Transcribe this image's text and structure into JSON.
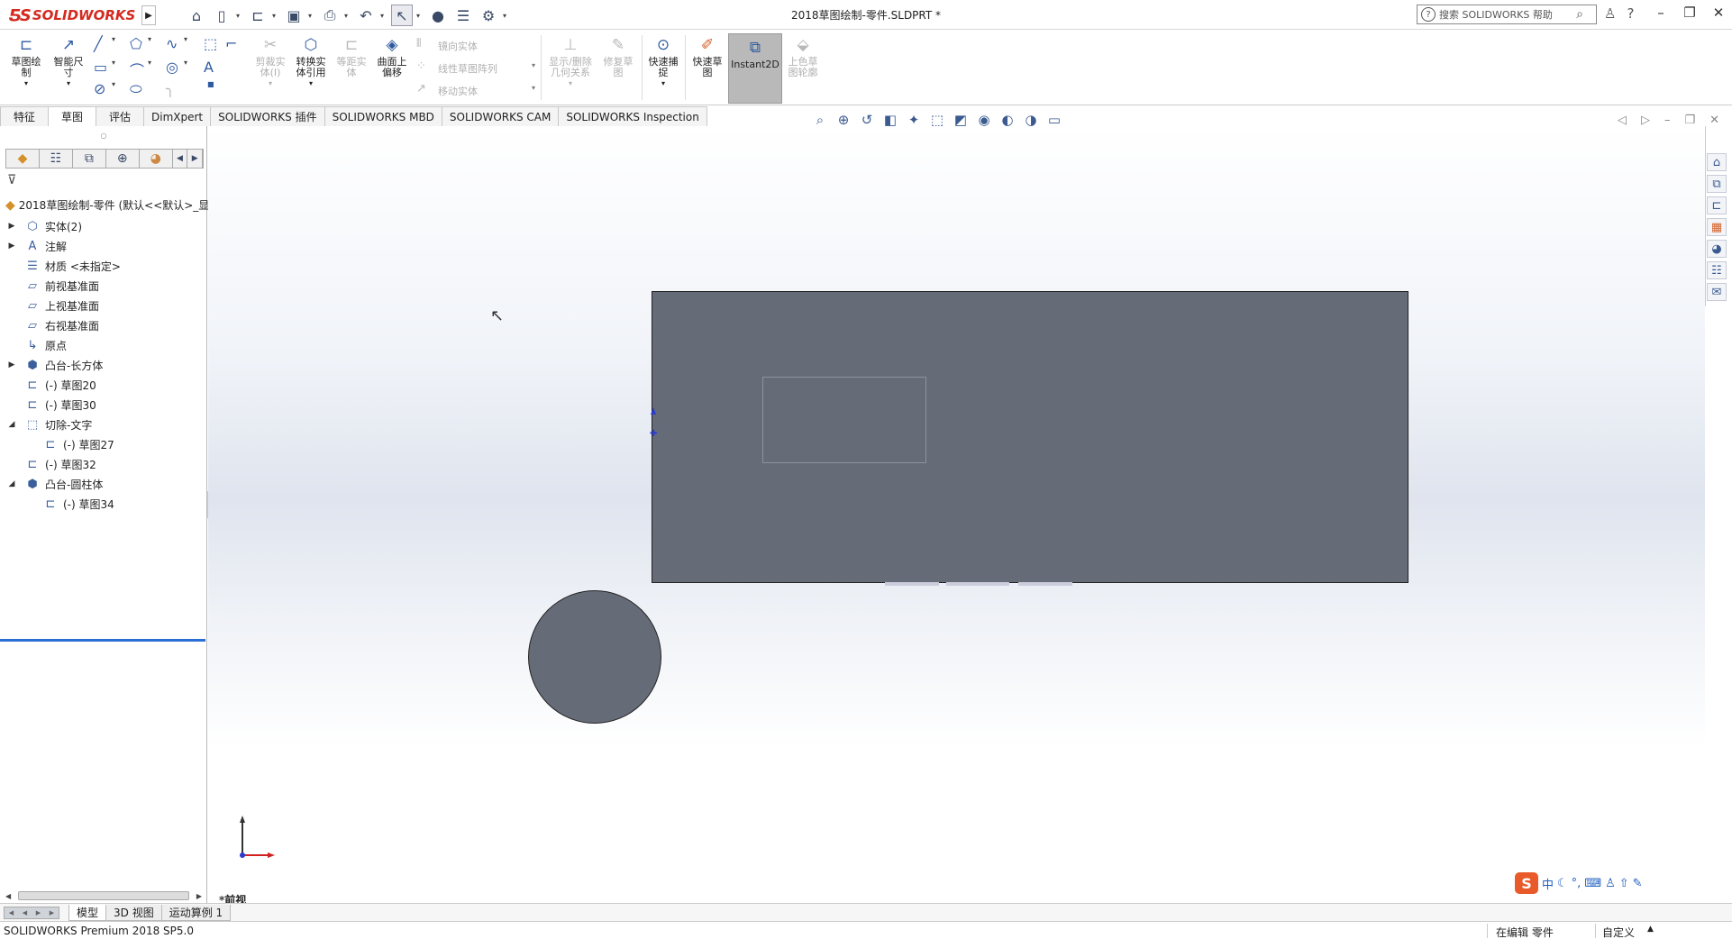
{
  "app": {
    "logo_text": "SOLIDWORKS",
    "document_title": "2018草图绘制-零件.SLDPRT *",
    "search_placeholder": "搜索 SOLIDWORKS 帮助"
  },
  "colors": {
    "brand": "#d42a20",
    "model_fill": "#666b78",
    "rollback_bar": "#2a6fd6",
    "origin": "#2a3bd0"
  },
  "quick_access": [
    "home-icon",
    "new-icon",
    "open-icon",
    "save-icon",
    "print-icon",
    "undo-icon",
    "select-icon",
    "rebuild-icon",
    "file-properties-icon",
    "options-icon"
  ],
  "command_manager": {
    "sketch": "草图绘\n制",
    "smart_dim": "智能尺\n寸",
    "trim": "剪裁实\n体(I)",
    "convert": "转换实\n体引用",
    "offset": "等距实\n体",
    "surface_offset": "曲面上\n偏移",
    "mirror": "镜向实体",
    "linear_pattern": "线性草图阵列",
    "move": "移动实体",
    "show_relations": "显示/删除\n几何关系",
    "repair": "修复草\n图",
    "quick_snap": "快速捕\n捉",
    "rapid_sketch": "快速草\n图",
    "instant2d": "Instant2D",
    "shaded_contour": "上色草\n图轮廓"
  },
  "tabs": [
    "特征",
    "草图",
    "评估",
    "DimXpert",
    "SOLIDWORKS 插件",
    "SOLIDWORKS MBD",
    "SOLIDWORKS CAM",
    "SOLIDWORKS Inspection"
  ],
  "feature_tree": {
    "root": "2018草图绘制-零件 (默认<<默认>_显",
    "items": [
      {
        "label": "实体(2)",
        "icon": "solid-bodies-icon",
        "expand": "right",
        "indent": 0
      },
      {
        "label": "注解",
        "icon": "annotations-icon",
        "expand": "right",
        "indent": 0
      },
      {
        "label": "材质 <未指定>",
        "icon": "material-icon",
        "expand": "",
        "indent": 0
      },
      {
        "label": "前视基准面",
        "icon": "plane-icon",
        "expand": "",
        "indent": 0
      },
      {
        "label": "上视基准面",
        "icon": "plane-icon",
        "expand": "",
        "indent": 0
      },
      {
        "label": "右视基准面",
        "icon": "plane-icon",
        "expand": "",
        "indent": 0
      },
      {
        "label": "原点",
        "icon": "origin-icon",
        "expand": "",
        "indent": 0
      },
      {
        "label": "凸台-长方体",
        "icon": "boss-extrude-icon",
        "expand": "right",
        "indent": 0
      },
      {
        "label": "(-) 草图20",
        "icon": "sketch-icon",
        "expand": "",
        "indent": 0
      },
      {
        "label": "(-) 草图30",
        "icon": "sketch-icon",
        "expand": "",
        "indent": 0
      },
      {
        "label": "切除-文字",
        "icon": "cut-extrude-icon",
        "expand": "down",
        "indent": 0
      },
      {
        "label": "(-) 草图27",
        "icon": "sketch-icon",
        "expand": "",
        "indent": 1
      },
      {
        "label": "(-) 草图32",
        "icon": "sketch-icon",
        "expand": "",
        "indent": 0
      },
      {
        "label": "凸台-圆柱体",
        "icon": "boss-extrude-icon",
        "expand": "down",
        "indent": 0
      },
      {
        "label": "(-) 草图34",
        "icon": "sketch-icon",
        "expand": "",
        "indent": 1
      }
    ]
  },
  "viewport": {
    "view_name": "*前视"
  },
  "bottom_tabs": [
    "模型",
    "3D 视图",
    "运动算例 1"
  ],
  "status_bar": {
    "product": "SOLIDWORKS Premium 2018 SP5.0",
    "mode": "在编辑 零件",
    "units": "自定义"
  },
  "ime": {
    "label": "中"
  }
}
